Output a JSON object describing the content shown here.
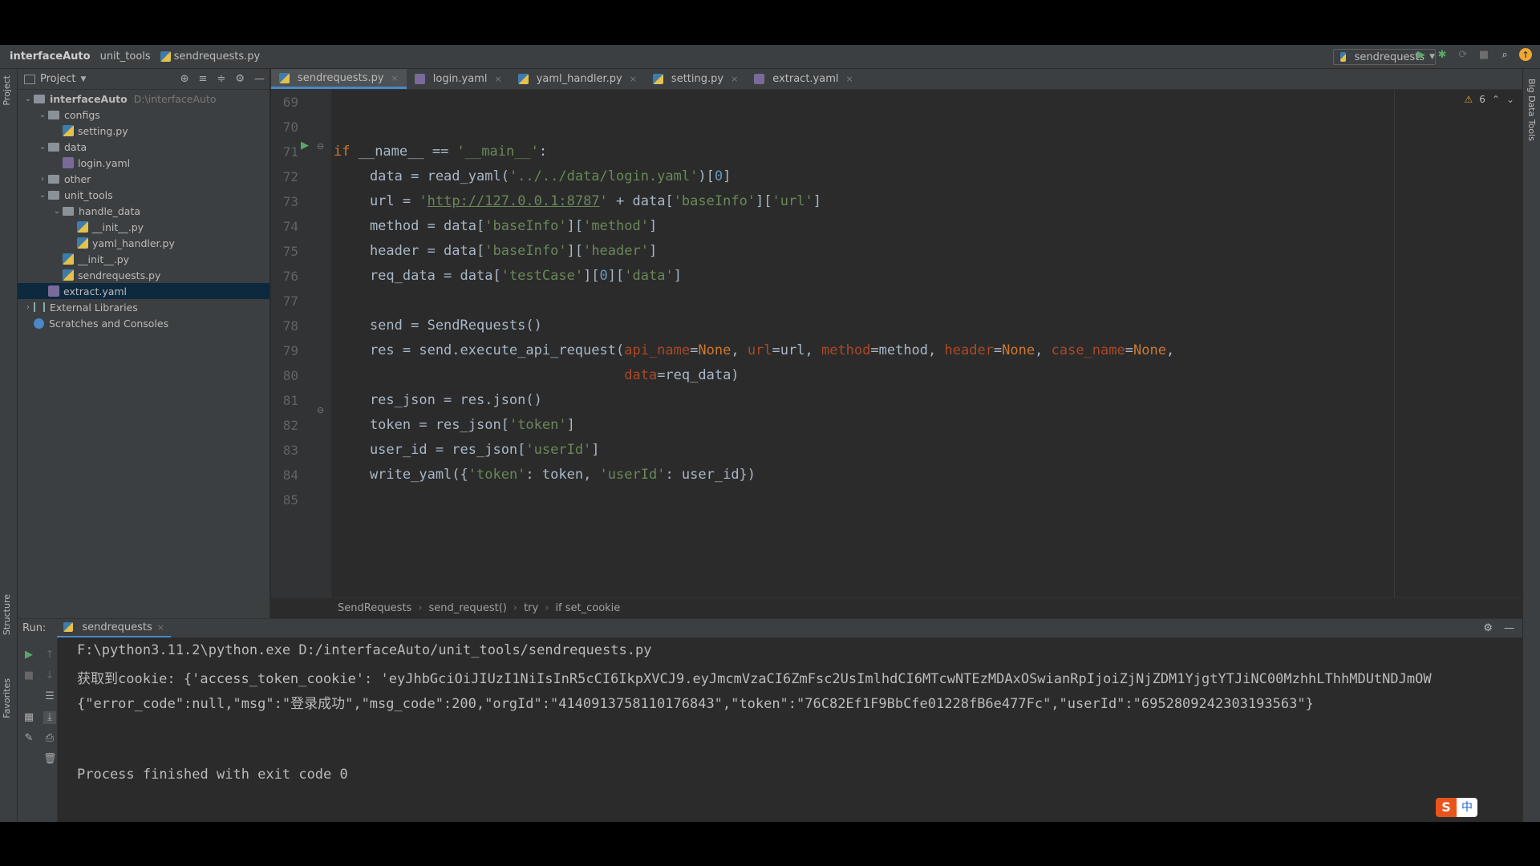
{
  "navbar": {
    "crumbs": [
      "interfaceAuto",
      "unit_tools",
      "sendrequests.py"
    ],
    "run_config": "sendrequests"
  },
  "left_stripe": {
    "project": "Project",
    "structure": "Structure",
    "favorites": "Favorites"
  },
  "right_stripe": {
    "bigdata": "Big Data Tools"
  },
  "project_panel": {
    "title": "Project",
    "tree": [
      {
        "label": "interfaceAuto",
        "extra": "D:\\interfaceAuto",
        "type": "folder",
        "depth": 0,
        "open": true
      },
      {
        "label": "configs",
        "type": "folder",
        "depth": 1,
        "open": true
      },
      {
        "label": "setting.py",
        "type": "py",
        "depth": 2
      },
      {
        "label": "data",
        "type": "folder",
        "depth": 1,
        "open": true
      },
      {
        "label": "login.yaml",
        "type": "yaml",
        "depth": 2
      },
      {
        "label": "other",
        "type": "folder",
        "depth": 1,
        "open": false
      },
      {
        "label": "unit_tools",
        "type": "folder",
        "depth": 1,
        "open": true
      },
      {
        "label": "handle_data",
        "type": "folder",
        "depth": 2,
        "open": true
      },
      {
        "label": "__init__.py",
        "type": "py",
        "depth": 3
      },
      {
        "label": "yaml_handler.py",
        "type": "py",
        "depth": 3
      },
      {
        "label": "__init__.py",
        "type": "py",
        "depth": 2
      },
      {
        "label": "sendrequests.py",
        "type": "py",
        "depth": 2
      },
      {
        "label": "extract.yaml",
        "type": "yaml",
        "depth": 1,
        "selected": true
      },
      {
        "label": "External Libraries",
        "type": "lib",
        "depth": 0,
        "open": false
      },
      {
        "label": "Scratches and Consoles",
        "type": "scratch",
        "depth": 0
      }
    ]
  },
  "editor_tabs": [
    {
      "label": "sendrequests.py",
      "type": "py",
      "active": true
    },
    {
      "label": "login.yaml",
      "type": "yaml"
    },
    {
      "label": "yaml_handler.py",
      "type": "py"
    },
    {
      "label": "setting.py",
      "type": "py"
    },
    {
      "label": "extract.yaml",
      "type": "yaml"
    }
  ],
  "editor": {
    "warnings": "6",
    "line_numbers": [
      "69",
      "70",
      "71",
      "72",
      "73",
      "74",
      "75",
      "76",
      "77",
      "78",
      "79",
      "80",
      "81",
      "82",
      "83",
      "84",
      "85"
    ],
    "breadcrumbs": [
      "SendRequests",
      "send_request()",
      "try",
      "if set_cookie"
    ]
  },
  "run_panel": {
    "label": "Run:",
    "tab": "sendrequests",
    "lines": [
      "F:\\python3.11.2\\python.exe D:/interfaceAuto/unit_tools/sendrequests.py",
      "获取到cookie: {'access_token_cookie': 'eyJhbGciOiJIUzI1NiIsInR5cCI6IkpXVCJ9.eyJmcmVzaCI6ZmFsc2UsImlhdCI6MTcwNTEzMDAxOSwianRpIjoiZjNjZDM1YjgtYTJiNC00MzhhLThhMDUtNDJmOW",
      "{\"error_code\":null,\"msg\":\"登录成功\",\"msg_code\":200,\"orgId\":\"4140913758110176843\",\"token\":\"76C82Ef1F9BbCfe01228fB6e477Fc\",\"userId\":\"6952809242303193563\"}",
      "",
      "Process finished with exit code 0"
    ]
  },
  "ime": {
    "logo": "S",
    "mode": "中"
  }
}
